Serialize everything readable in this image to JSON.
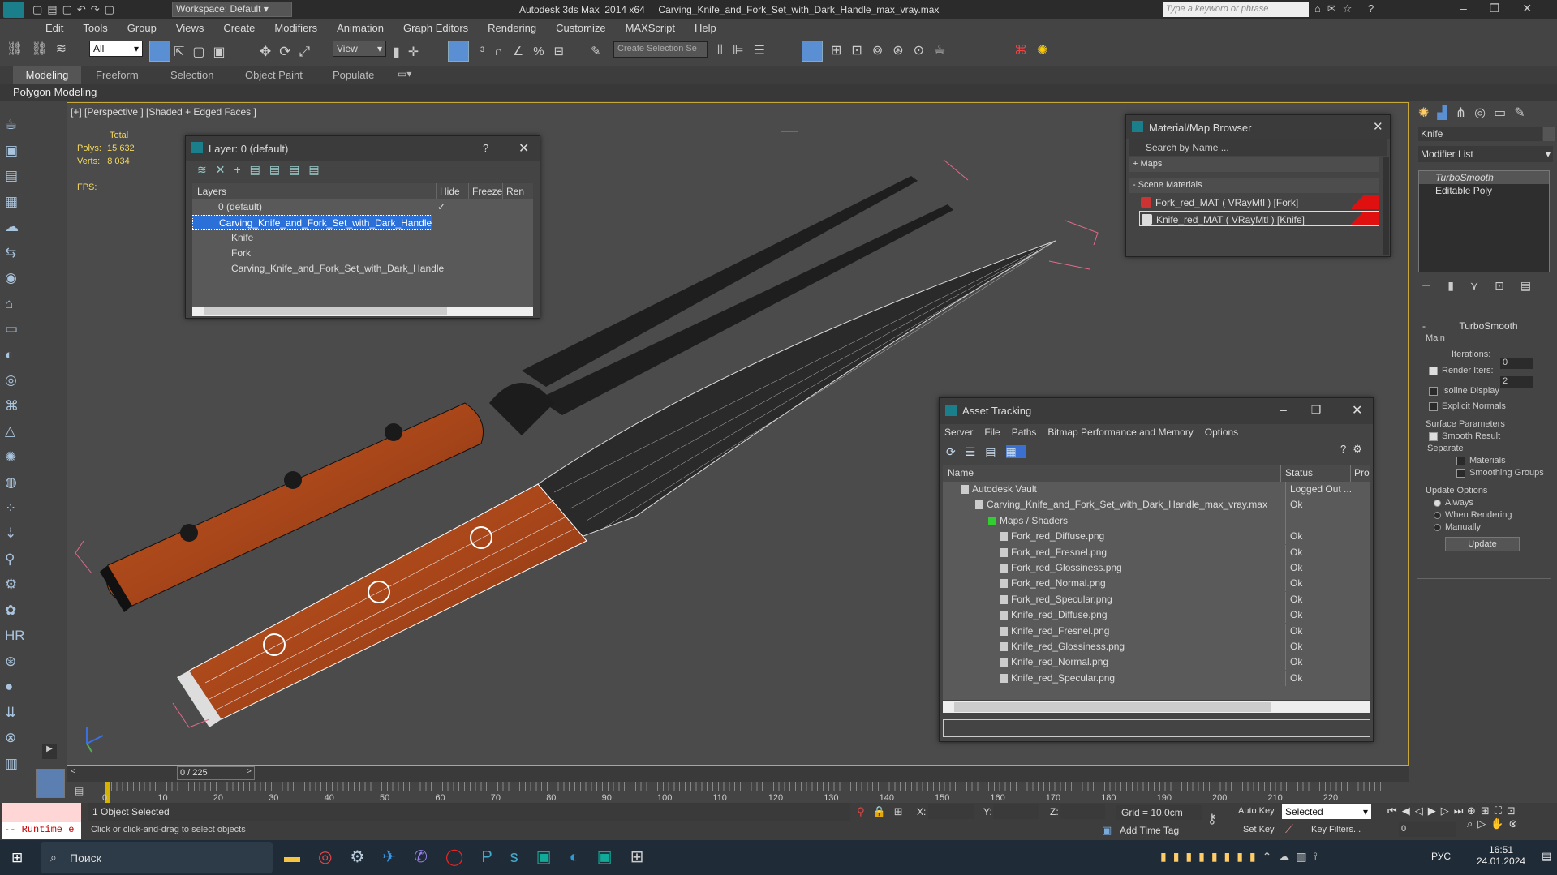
{
  "app": {
    "workspace": "Workspace: Default",
    "title": "Autodesk 3ds Max  2014 x64     Carving_Knife_and_Fork_Set_with_Dark_Handle_max_vray.max",
    "search_placeholder": "Type a keyword or phrase"
  },
  "menu": [
    "Edit",
    "Tools",
    "Group",
    "Views",
    "Create",
    "Modifiers",
    "Animation",
    "Graph Editors",
    "Rendering",
    "Customize",
    "MAXScript",
    "Help"
  ],
  "toolbar": {
    "filter": "All",
    "refcoord": "View",
    "selection_set": "Create Selection Se"
  },
  "ribbon": {
    "tabs": [
      "Modeling",
      "Freeform",
      "Selection",
      "Object Paint",
      "Populate"
    ],
    "sub": "Polygon Modeling"
  },
  "viewport": {
    "label": "[+] [Perspective ] [Shaded + Edged Faces ]",
    "stats_header": "Total",
    "polys_label": "Polys:",
    "polys": "15 632",
    "verts_label": "Verts:",
    "verts": "8 034",
    "fps_label": "FPS:"
  },
  "layer_panel": {
    "title": "Layer: 0 (default)",
    "help": "?",
    "columns": [
      "Layers",
      "Hide",
      "Freeze",
      "Ren"
    ],
    "rows": [
      {
        "name": "0 (default)"
      },
      {
        "name": "Carving_Knife_and_Fork_Set_with_Dark_Handle"
      },
      {
        "name": "Knife"
      },
      {
        "name": "Fork"
      },
      {
        "name": "Carving_Knife_and_Fork_Set_with_Dark_Handle"
      }
    ]
  },
  "material_browser": {
    "title": "Material/Map Browser",
    "search_placeholder": "Search by Name ...",
    "groups": [
      "+ Maps",
      "- Scene Materials"
    ],
    "materials": [
      "Fork_red_MAT  ( VRayMtl )  [Fork]",
      "Knife_red_MAT  ( VRayMtl )  [Knife]"
    ]
  },
  "asset_tracking": {
    "title": "Asset Tracking",
    "menu": [
      "Server",
      "File",
      "Paths",
      "Bitmap Performance and Memory",
      "Options"
    ],
    "columns": [
      "Name",
      "Status",
      "Pro"
    ],
    "rows": [
      {
        "name": "Autodesk Vault",
        "status": "Logged Out ..."
      },
      {
        "name": "Carving_Knife_and_Fork_Set_with_Dark_Handle_max_vray.max",
        "status": "Ok"
      },
      {
        "name": "Maps / Shaders",
        "status": ""
      },
      {
        "name": "Fork_red_Diffuse.png",
        "status": "Ok"
      },
      {
        "name": "Fork_red_Fresnel.png",
        "status": "Ok"
      },
      {
        "name": "Fork_red_Glossiness.png",
        "status": "Ok"
      },
      {
        "name": "Fork_red_Normal.png",
        "status": "Ok"
      },
      {
        "name": "Fork_red_Specular.png",
        "status": "Ok"
      },
      {
        "name": "Knife_red_Diffuse.png",
        "status": "Ok"
      },
      {
        "name": "Knife_red_Fresnel.png",
        "status": "Ok"
      },
      {
        "name": "Knife_red_Glossiness.png",
        "status": "Ok"
      },
      {
        "name": "Knife_red_Normal.png",
        "status": "Ok"
      },
      {
        "name": "Knife_red_Specular.png",
        "status": "Ok"
      }
    ]
  },
  "command_panel": {
    "object_name": "Knife",
    "modifier_list": "Modifier List",
    "stack": [
      "TurboSmooth",
      "Editable Poly"
    ],
    "rollout_title": "TurboSmooth",
    "main_label": "Main",
    "iterations_label": "Iterations:",
    "iterations": "0",
    "render_iters_label": "Render Iters:",
    "render_iters": "2",
    "isoline": "Isoline Display",
    "explicit": "Explicit Normals",
    "surface_params": "Surface Parameters",
    "smooth_result": "Smooth Result",
    "separate": "Separate",
    "materials": "Materials",
    "smoothing_groups": "Smoothing Groups",
    "update_options": "Update Options",
    "always": "Always",
    "when_rendering": "When Rendering",
    "manually": "Manually",
    "update_btn": "Update"
  },
  "timeline": {
    "frame": "0 / 225",
    "ticks": [
      "0",
      "10",
      "20",
      "30",
      "40",
      "50",
      "60",
      "70",
      "80",
      "90",
      "100",
      "110",
      "120",
      "130",
      "140",
      "150",
      "160",
      "170",
      "180",
      "190",
      "200",
      "210",
      "220"
    ]
  },
  "status": {
    "script": "-- Runtime e",
    "selected": "1 Object Selected",
    "prompt": "Click or click-and-drag to select objects",
    "x": "X:",
    "y": "Y:",
    "z": "Z:",
    "grid": "Grid = 10,0cm",
    "add_time_tag": "Add Time Tag",
    "auto_key": "Auto Key",
    "set_key": "Set Key",
    "key_mode": "Selected",
    "key_filters": "Key Filters...",
    "frame_field": "0"
  },
  "taskbar": {
    "search": "Поиск",
    "lang": "РУС",
    "time": "16:51",
    "date": "24.01.2024"
  }
}
